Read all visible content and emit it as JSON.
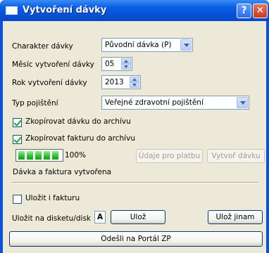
{
  "window": {
    "title": "Vytvoření dávky",
    "help_glyph": "?",
    "close_glyph": "✕"
  },
  "form": {
    "batch_type_label": "Charakter dávky",
    "batch_type_value": "Původní dávka (P)",
    "month_label": "Měsíc vytvoření dávky",
    "month_value": "05",
    "year_label": "Rok vytvoření dávky",
    "year_value": "2013",
    "insurance_label": "Typ pojištění",
    "insurance_value": "Veřejné zdravotní pojištění",
    "copy_batch_label": "Zkopírovat dávku do archívu",
    "copy_batch_checked": true,
    "copy_invoice_label": "Zkopírovat fakturu do archívu",
    "copy_invoice_checked": true
  },
  "progress": {
    "value": 1.0,
    "label": "100%"
  },
  "actions": {
    "payment_data_label": "Údaje pro platbu",
    "create_batch_label": "Vytvoř dávku"
  },
  "status": {
    "text": "Dávka a faktura vytvořena"
  },
  "save": {
    "save_invoice_label": "Uložit i fakturu",
    "save_invoice_checked": false,
    "disk_label": "Uložit na disketu/disk",
    "disk_value": "A",
    "save_label": "Ulož",
    "save_elsewhere_label": "Ulož jinam",
    "send_portal_label": "Odešli na Portál ZP"
  }
}
